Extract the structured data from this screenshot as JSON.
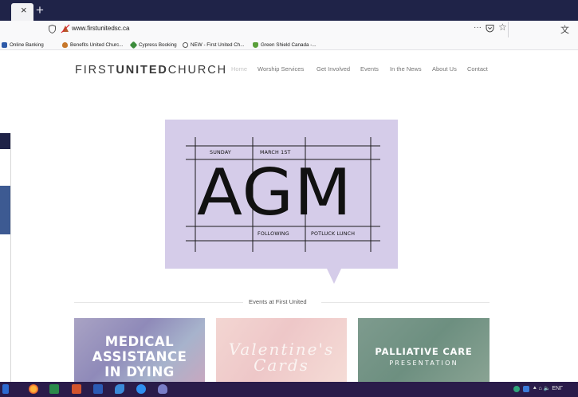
{
  "browser": {
    "tab_close": "×",
    "new_tab": "+",
    "url": "www.firstunitedsc.ca",
    "more_button": "···",
    "bookmark_star": "☆",
    "extension_icon": "⽂",
    "bookmarks": [
      {
        "label": "Online Banking",
        "color": "#2d5aa8"
      },
      {
        "label": "Benefits United Churc...",
        "color": "#c7772a"
      },
      {
        "label": "Cypress Booking",
        "color": "#3c8c3c"
      },
      {
        "label": "NEW - First United Ch...",
        "color": "#555555"
      },
      {
        "label": "Green Shield Canada -...",
        "color": "#5aa03a"
      }
    ]
  },
  "site": {
    "logo_first": "FIRST",
    "logo_united": "UNITED",
    "logo_church": "CHURCH",
    "nav": [
      "Home",
      "Worship Services",
      "Get Involved",
      "Events",
      "In the News",
      "About Us",
      "Contact"
    ],
    "active_nav": "Home"
  },
  "poster": {
    "sunday": "SUNDAY",
    "date": "MARCH 1ST",
    "headline": "AGM",
    "following": "FOLLOWING",
    "potluck": "POTLUCK LUNCH",
    "background": "#d5cce9"
  },
  "events": {
    "title": "Events at First United",
    "cards": [
      {
        "line1": "MEDICAL",
        "line2": "ASSISTANCE",
        "line3": "IN DYING"
      },
      {
        "line1": "Valentine's",
        "line2": "Cards"
      },
      {
        "line1": "PALLIATIVE CARE",
        "line2": "PRESENTATION"
      }
    ]
  },
  "taskbar": {
    "tray_text": "⯅ ⌂ 🔈 ΕΝΓ"
  }
}
